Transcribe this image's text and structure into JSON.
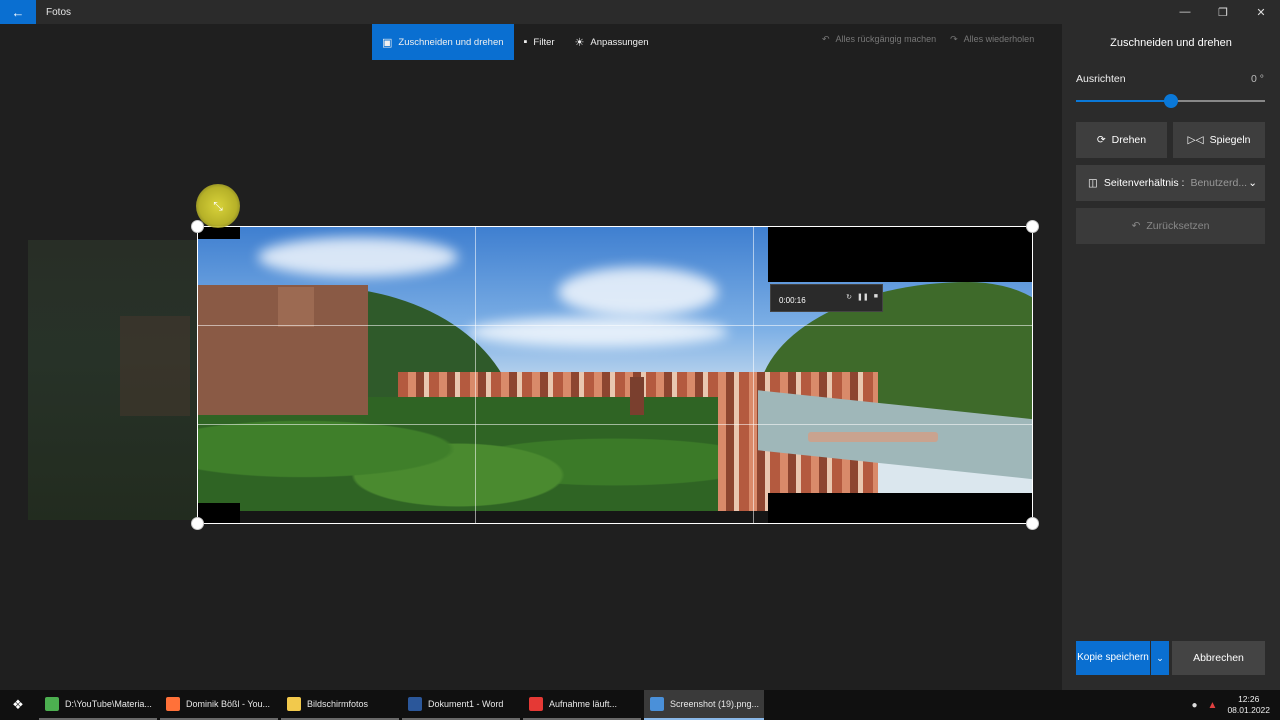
{
  "window": {
    "app_title": "Fotos",
    "back_icon": "back-arrow-icon",
    "controls": [
      "minimize",
      "restore",
      "close"
    ]
  },
  "toolbar": {
    "crop_rotate": "Zuschneiden und drehen",
    "filter": "Filter",
    "adjustments": "Anpassungen",
    "undo_all": "Alles rückgängig machen",
    "redo_all": "Alles wiederholen"
  },
  "panel": {
    "title": "Zuschneiden und drehen",
    "straighten_label": "Ausrichten",
    "straighten_value": "0 °",
    "straighten_fraction": 0.5,
    "rotate": "Drehen",
    "mirror": "Spiegeln",
    "aspect_label": "Seitenverhältnis :",
    "aspect_value": "Benutzerd...",
    "reset": "Zurücksetzen",
    "save_copy": "Kopie speichern",
    "cancel": "Abbrechen",
    "accent": "#0a6fd1"
  },
  "image": {
    "recorder_time": "0:00:16"
  },
  "taskbar": {
    "items": [
      {
        "label": "D:\\YouTube\\Materia...",
        "icon": "folder-icon",
        "color": "#4caf50"
      },
      {
        "label": "Dominik Bößl - You...",
        "icon": "firefox-icon",
        "color": "#ff7139"
      },
      {
        "label": "Bildschirmfotos",
        "icon": "folder-icon",
        "color": "#f2c94c"
      },
      {
        "label": "Dokument1 - Word",
        "icon": "word-icon",
        "color": "#2b579a"
      },
      {
        "label": "Aufnahme läuft...",
        "icon": "recorder-icon",
        "color": "#e53935"
      },
      {
        "label": "Screenshot (19).png...",
        "icon": "photos-icon",
        "color": "#4a90d9"
      }
    ],
    "time": "12:26",
    "date": "08.01.2022"
  }
}
